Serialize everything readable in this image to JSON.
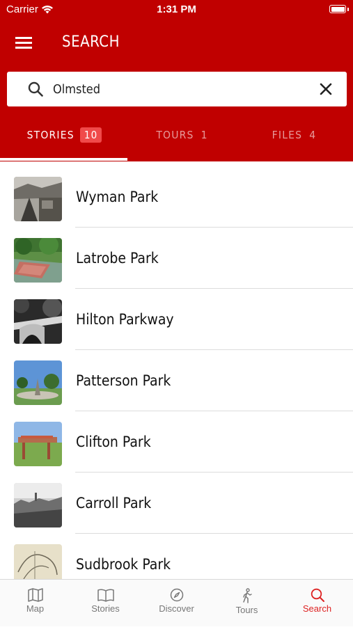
{
  "status_bar": {
    "carrier": "Carrier",
    "time": "1:31 PM"
  },
  "header": {
    "title": "SEARCH"
  },
  "search": {
    "value": "Olmsted"
  },
  "tabs": [
    {
      "label": "STORIES",
      "count": "10",
      "active": true
    },
    {
      "label": "TOURS",
      "count": "1",
      "active": false
    },
    {
      "label": "FILES",
      "count": "4",
      "active": false
    }
  ],
  "results": [
    {
      "title": "Wyman Park"
    },
    {
      "title": "Latrobe Park"
    },
    {
      "title": "Hilton Parkway"
    },
    {
      "title": "Patterson Park"
    },
    {
      "title": "Clifton Park"
    },
    {
      "title": "Carroll Park"
    },
    {
      "title": "Sudbrook Park"
    }
  ],
  "tab_bar": {
    "map": "Map",
    "stories": "Stories",
    "discover": "Discover",
    "tours": "Tours",
    "search": "Search"
  },
  "colors": {
    "brand": "#c00000",
    "badge": "#f04a4a",
    "active_tab_icon": "#dd2222"
  }
}
